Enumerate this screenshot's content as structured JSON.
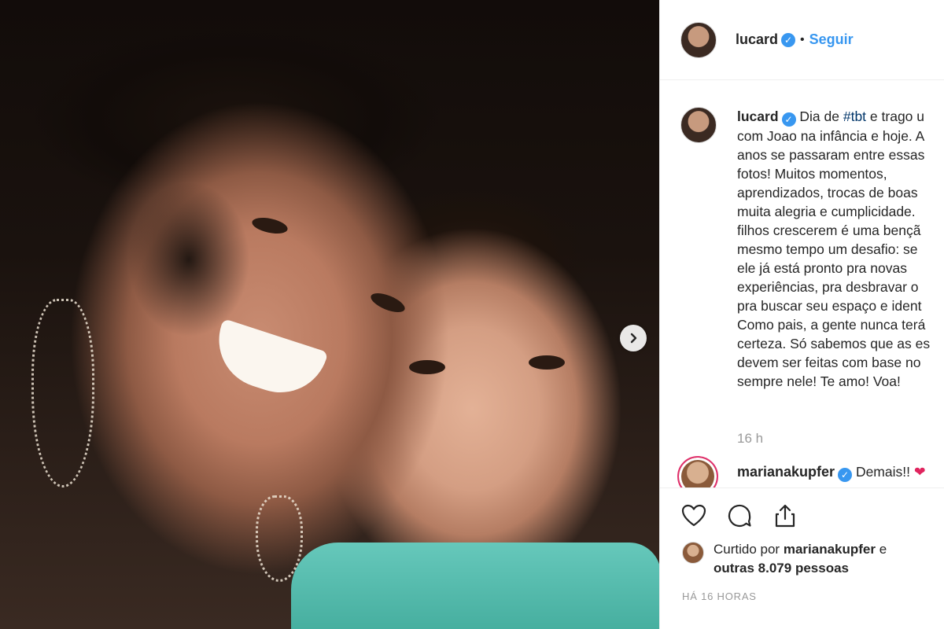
{
  "post": {
    "author": "lucard",
    "follow_label": "Seguir",
    "separator": "•",
    "verified_glyph": "✓"
  },
  "caption": {
    "author": "lucard",
    "lines": [
      "Dia de #tbt e trago u",
      "com Joao na infância e hoje. A",
      "anos se passaram entre essas",
      "fotos! Muitos momentos,",
      "aprendizados, trocas de boas",
      "muita alegria e cumplicidade.",
      "filhos crescerem é uma bençã",
      "mesmo tempo um desafio: se",
      "ele já está pronto pra novas",
      "experiências, pra desbravar o",
      "pra buscar seu espaço e ident",
      "Como pais, a gente nunca terá",
      "certeza. Só sabemos que as es",
      "devem ser feitas com base no",
      "sempre nele! Te amo! Voa!"
    ],
    "hashtag": "#tbt",
    "time_ago": "16 h"
  },
  "comment": {
    "author": "marianakupfer",
    "text": "Demais!!",
    "emoji": "❤"
  },
  "likes": {
    "prefix": "Curtido por",
    "liker": "marianakupfer",
    "connector": "e",
    "others": "outras 8.079 pessoas"
  },
  "post_date": "HÁ 16 HORAS",
  "icons": {
    "like": "heart-icon",
    "comment": "comment-bubble-icon",
    "share": "share-icon",
    "next": "chevron-right-icon",
    "verified": "verified-badge-icon"
  },
  "colors": {
    "link_blue": "#3897f0",
    "text": "#262626",
    "muted": "#999999",
    "story_ring": "#e1306c"
  }
}
